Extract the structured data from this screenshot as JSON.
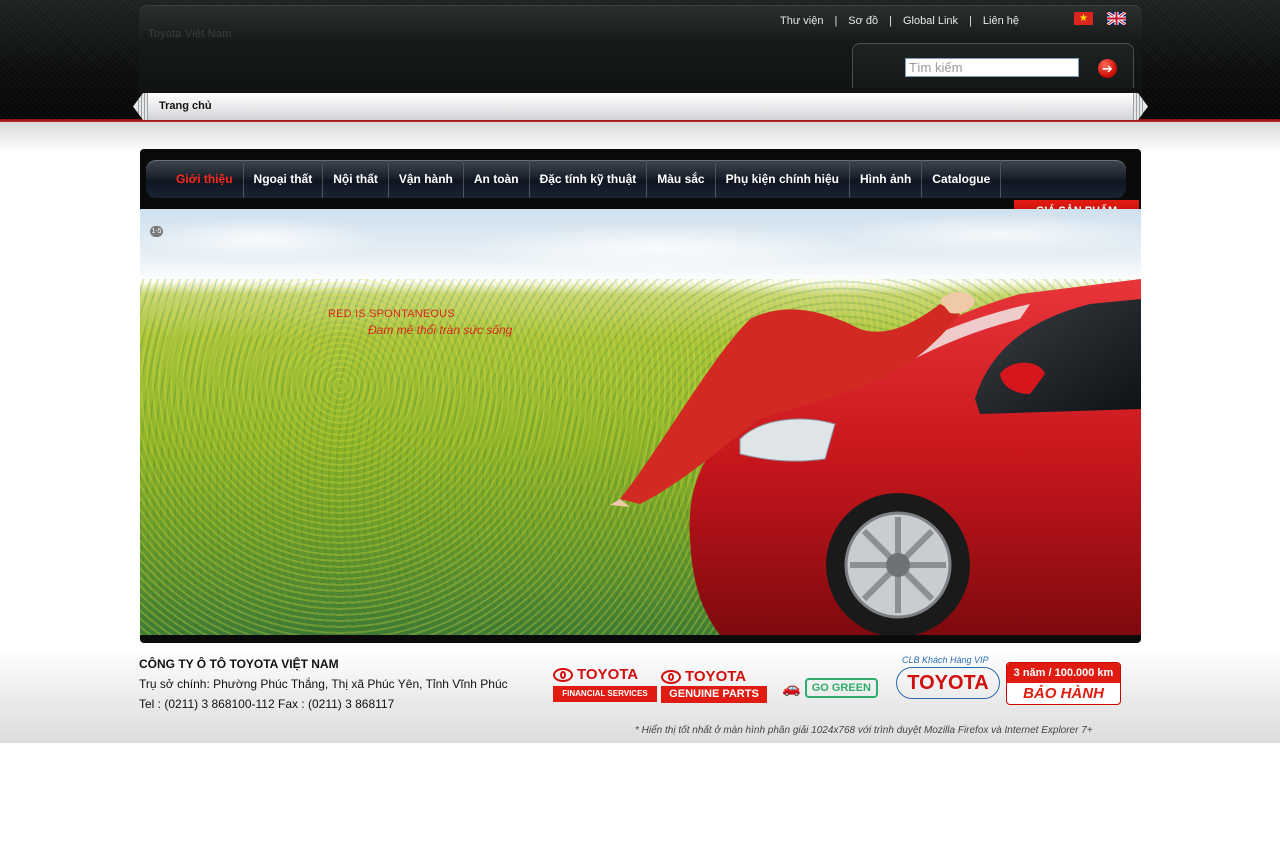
{
  "header": {
    "logo_text": "Toyota Việt Nam",
    "top_links": [
      "Thư viện",
      "Sơ đồ",
      "Global Link",
      "Liên hệ"
    ],
    "languages": [
      {
        "code": "vi",
        "icon": "vietnam-flag-icon"
      },
      {
        "code": "en",
        "icon": "uk-flag-icon"
      }
    ],
    "search": {
      "placeholder": "Tìm kiếm",
      "value": "",
      "button_icon": "arrow-right-icon"
    }
  },
  "breadcrumb": {
    "home": "Trang chủ"
  },
  "nav": {
    "items": [
      "Giới thiệu",
      "Ngoại thất",
      "Nội thất",
      "Vận hành",
      "An toàn",
      "Đặc tính kỹ thuật",
      "Màu sắc",
      "Phụ kiện chính hiệu",
      "Hình ảnh",
      "Catalogue"
    ],
    "active_index": 0,
    "active_color": "#ff2a1a"
  },
  "price_tab": {
    "label": "GIÁ SẢN PHẨM"
  },
  "hero": {
    "slide_indicator": "1-5",
    "tagline_en": "RED IS SPONTANEOUS",
    "tagline_vi": "Đam mê thổi tràn sức sống",
    "car_color": "#c8161d"
  },
  "footer": {
    "company_name": "CÔNG TY Ô TÔ TOYOTA VIỆT NAM",
    "address": "Trụ sở chính: Phường Phúc Thắng, Thị xã Phúc Yên, Tỉnh Vĩnh Phúc",
    "contact": "Tel : (0211) 3 868100-112 Fax : (0211) 3 868117",
    "partner_logos": {
      "financial": {
        "brand": "TOYOTA",
        "subtitle": "FINANCIAL SERVICES"
      },
      "parts": {
        "brand": "TOYOTA",
        "subtitle": "GENUINE PARTS"
      },
      "eco": {
        "label": "GO GREEN"
      },
      "vip": {
        "club": "CLB Khách Hàng VIP",
        "brand": "TOYOTA"
      },
      "warranty": {
        "top": "3 năm / 100.000 km",
        "bottom": "BẢO HÀNH"
      }
    },
    "note": "* Hiển thị tốt nhất ở màn hình phân giải 1024x768 với trình duyệt Mozilla Firefox và Internet Explorer 7+"
  },
  "colors": {
    "brand_red": "#e01c12",
    "header_dark": "#0b0d0c"
  }
}
